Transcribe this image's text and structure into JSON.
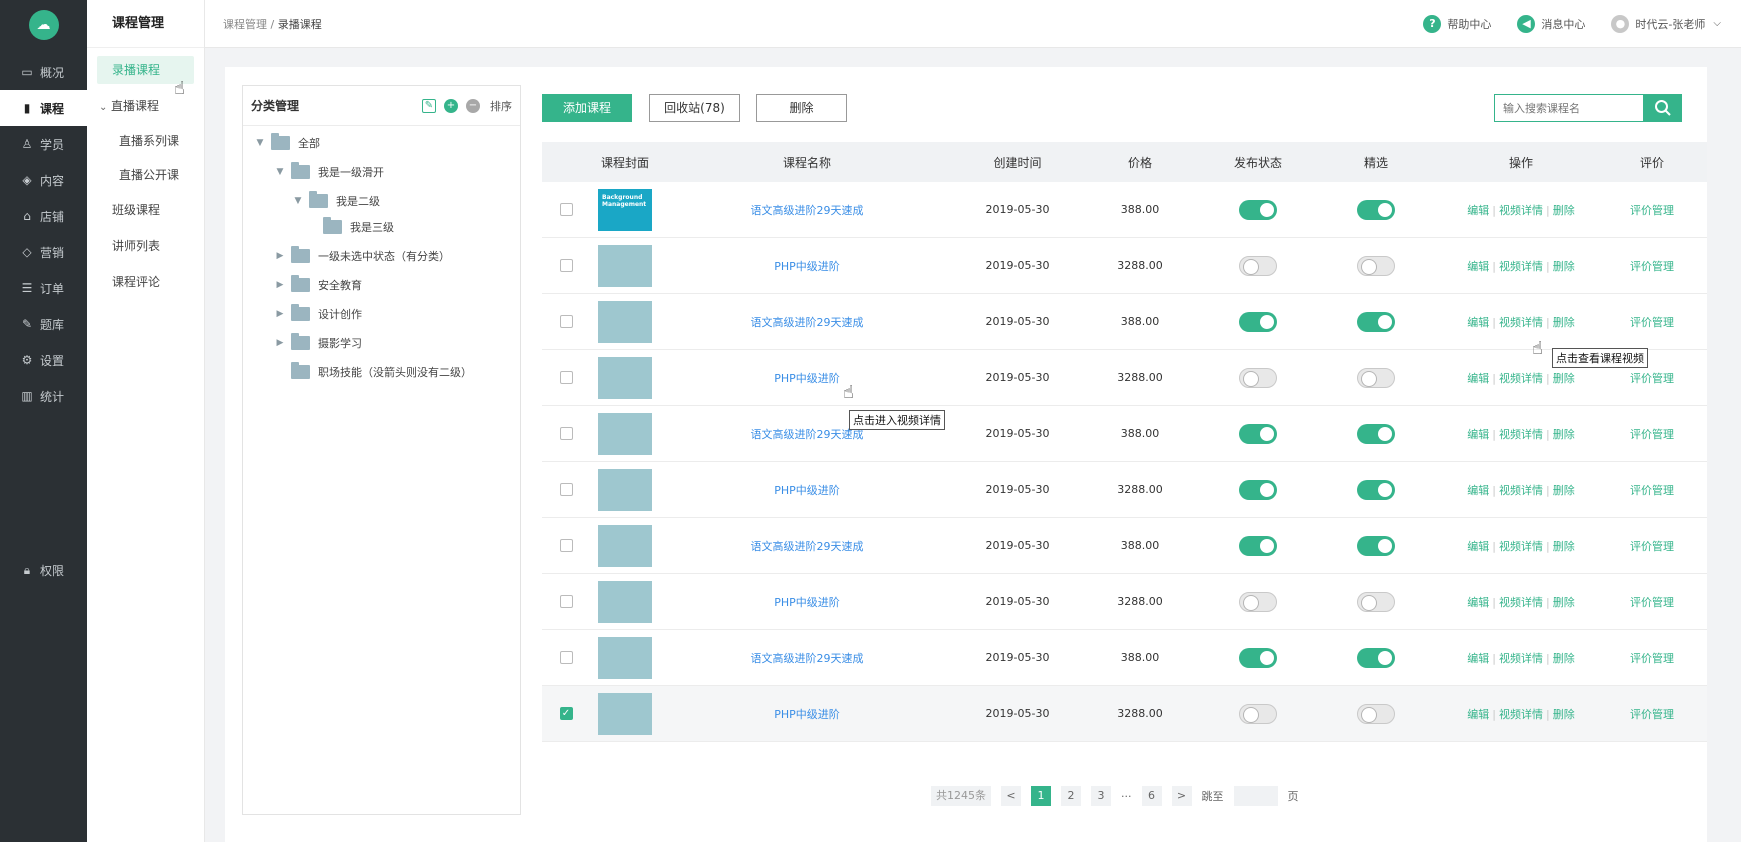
{
  "nav": {
    "items": [
      {
        "label": "概况",
        "icon": "monitor-icon"
      },
      {
        "label": "课程",
        "icon": "book-icon"
      },
      {
        "label": "学员",
        "icon": "user-icon"
      },
      {
        "label": "内容",
        "icon": "cube-icon"
      },
      {
        "label": "店铺",
        "icon": "store-icon"
      },
      {
        "label": "营销",
        "icon": "tag-icon"
      },
      {
        "label": "订单",
        "icon": "order-icon"
      },
      {
        "label": "题库",
        "icon": "pen-icon"
      },
      {
        "label": "设置",
        "icon": "gear-icon"
      },
      {
        "label": "统计",
        "icon": "bar-chart-icon"
      }
    ],
    "bottom": {
      "label": "权限",
      "icon": "lock-icon"
    }
  },
  "subnav": {
    "title": "课程管理",
    "recorded": "录播课程",
    "live_group": "直播课程",
    "live_series": "直播系列课",
    "live_public": "直播公开课",
    "class_course": "班级课程",
    "teachers": "讲师列表",
    "comments": "课程评论"
  },
  "header": {
    "crumb_parent": "课程管理",
    "crumb_sep": " / ",
    "crumb_current": "录播课程",
    "help": "帮助中心",
    "messages": "消息中心",
    "user": "时代云-张老师"
  },
  "category": {
    "title": "分类管理",
    "sort": "排序",
    "tree": [
      {
        "label": "全部"
      },
      {
        "label": "我是一级滑开"
      },
      {
        "label": "我是二级"
      },
      {
        "label": "我是三级"
      },
      {
        "label": "一级未选中状态（有分类）"
      },
      {
        "label": "安全教育"
      },
      {
        "label": "设计创作"
      },
      {
        "label": "摄影学习"
      },
      {
        "label": "职场技能（没箭头则没有二级）"
      }
    ]
  },
  "toolbar": {
    "add": "添加课程",
    "recycle": "回收站(78)",
    "delete": "删除",
    "search_placeholder": "输入搜索课程名"
  },
  "table": {
    "headers": {
      "cover": "课程封面",
      "name": "课程名称",
      "time": "创建时间",
      "price": "价格",
      "publish": "发布状态",
      "featured": "精选",
      "ops": "操作",
      "eval": "评价"
    },
    "op_edit": "编辑",
    "op_video": "视频详情",
    "op_delete": "删除",
    "eval_link": "评价管理",
    "cover_text": "Background Management",
    "rows": [
      {
        "name": "语文高级进阶29天速成",
        "time": "2019-05-30",
        "price": "388.00",
        "publish": true,
        "featured": true,
        "checked": false
      },
      {
        "name": "PHP中级进阶",
        "time": "2019-05-30",
        "price": "3288.00",
        "publish": false,
        "featured": false,
        "checked": false
      },
      {
        "name": "语文高级进阶29天速成",
        "time": "2019-05-30",
        "price": "388.00",
        "publish": true,
        "featured": true,
        "checked": false
      },
      {
        "name": "PHP中级进阶",
        "time": "2019-05-30",
        "price": "3288.00",
        "publish": false,
        "featured": false,
        "checked": false
      },
      {
        "name": "语文高级进阶29天速成",
        "time": "2019-05-30",
        "price": "388.00",
        "publish": true,
        "featured": true,
        "checked": false
      },
      {
        "name": "PHP中级进阶",
        "time": "2019-05-30",
        "price": "3288.00",
        "publish": true,
        "featured": true,
        "checked": false
      },
      {
        "name": "语文高级进阶29天速成",
        "time": "2019-05-30",
        "price": "388.00",
        "publish": true,
        "featured": true,
        "checked": false
      },
      {
        "name": "PHP中级进阶",
        "time": "2019-05-30",
        "price": "3288.00",
        "publish": false,
        "featured": false,
        "checked": false
      },
      {
        "name": "语文高级进阶29天速成",
        "time": "2019-05-30",
        "price": "388.00",
        "publish": true,
        "featured": true,
        "checked": false
      },
      {
        "name": "PHP中级进阶",
        "time": "2019-05-30",
        "price": "3288.00",
        "publish": false,
        "featured": false,
        "checked": true
      }
    ]
  },
  "tooltips": {
    "video": "点击查看课程视频",
    "detail": "点击进入视频详情"
  },
  "pagination": {
    "total": "共1245条",
    "prev": "<",
    "pages": [
      "1",
      "2",
      "3"
    ],
    "ellipsis": "···",
    "last": "6",
    "next": ">",
    "goto": "跳至",
    "page_unit": "页"
  },
  "colors": {
    "accent": "#35b48b",
    "link": "#3a8ee6",
    "nav_bg": "#2b3034"
  }
}
